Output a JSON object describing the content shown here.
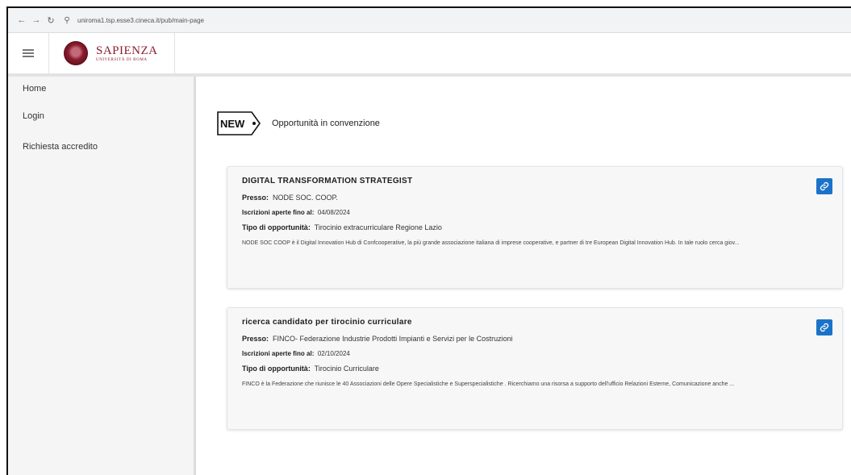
{
  "browser": {
    "url": "uniroma1.tsp.esse3.cineca.it/pub/main-page"
  },
  "brand": {
    "title": "SAPIENZA",
    "subtitle": "UNIVERSITÀ DI ROMA",
    "color": "#8a1c2d"
  },
  "sidebar": {
    "items": [
      {
        "label": "Home"
      },
      {
        "label": "Login"
      },
      {
        "label": "Richiesta accredito"
      }
    ]
  },
  "section": {
    "badge": "NEW",
    "title": "Opportunità in convenzione"
  },
  "cards": [
    {
      "title": "DIGITAL TRANSFORMATION STRATEGIST",
      "presso_label": "Presso:",
      "presso_value": "NODE SOC. COOP.",
      "iscrizioni_label": "Iscrizioni aperte fino al:",
      "iscrizioni_value": "04/08/2024",
      "tipo_label": "Tipo di opportunità:",
      "tipo_value": "Tirocinio extracurriculare Regione Lazio",
      "description": "NODE SOC COOP è il Digital Innovation Hub di Confcooperative, la più grande associazione italiana di imprese cooperative, e partner di tre European Digital Innovation Hub. In tale ruolo cerca giov...",
      "link_icon": "link-icon"
    },
    {
      "title": "ricerca candidato per tirocinio curriculare",
      "presso_label": "Presso:",
      "presso_value": "FINCO- Federazione Industrie Prodotti Impianti e Servizi per le Costruzioni",
      "iscrizioni_label": "Iscrizioni aperte fino al:",
      "iscrizioni_value": "02/10/2024",
      "tipo_label": "Tipo di opportunità:",
      "tipo_value": "Tirocinio Curriculare",
      "description": "FINCO è la Federazione che riunisce le 40 Associazioni delle Opere Specialistiche e Superspecialistiche . Ricerchiamo una risorsa a supporto dell'ufficio Relazioni Esterne, Comunicazione anche ...",
      "link_icon": "link-icon"
    }
  ],
  "colors": {
    "accent": "#1a73c8",
    "sidebar_bg": "#f5f5f5",
    "card_bg": "#f7f7f8"
  }
}
